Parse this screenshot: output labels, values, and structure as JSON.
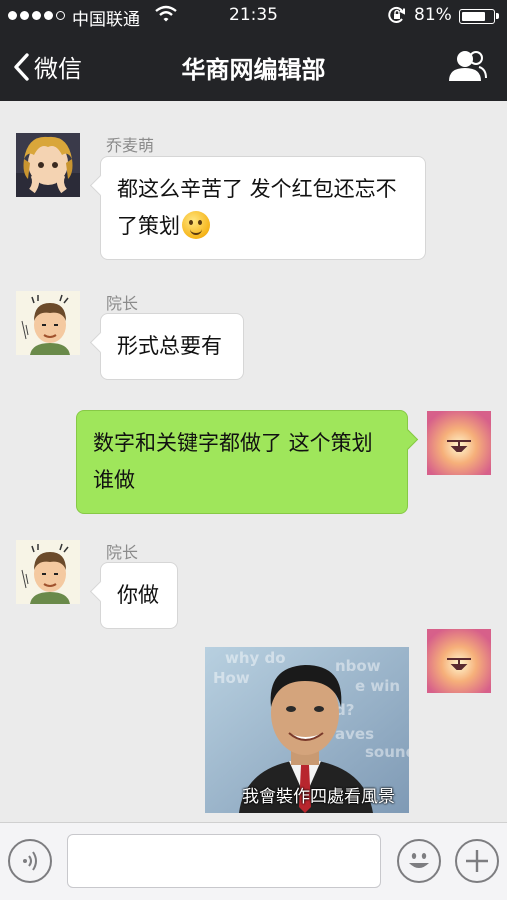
{
  "status_bar": {
    "carrier": "中国联通",
    "time": "21:35",
    "battery_percent": "81%",
    "battery_level": 0.81
  },
  "nav": {
    "back_label": "微信",
    "title": "华商网编辑部"
  },
  "messages": [
    {
      "sender": "乔麦萌",
      "direction": "incoming",
      "text": "都这么辛苦了 发个红包还忘不了策划",
      "emoji": "thinking-face-emoji"
    },
    {
      "sender": "院长",
      "direction": "incoming",
      "text": "形式总要有"
    },
    {
      "direction": "outgoing",
      "text": "数字和关键字都做了 这个策划谁做"
    },
    {
      "sender": "院长",
      "direction": "incoming",
      "text": "你做"
    },
    {
      "direction": "outgoing",
      "type": "sticker",
      "caption": "我會裝作四處看風景"
    }
  ],
  "input_bar": {
    "placeholder": ""
  },
  "colors": {
    "nav_background": "#232427",
    "chat_background": "#ebebeb",
    "outgoing_bubble": "#9fe65b",
    "incoming_bubble": "#ffffff"
  }
}
